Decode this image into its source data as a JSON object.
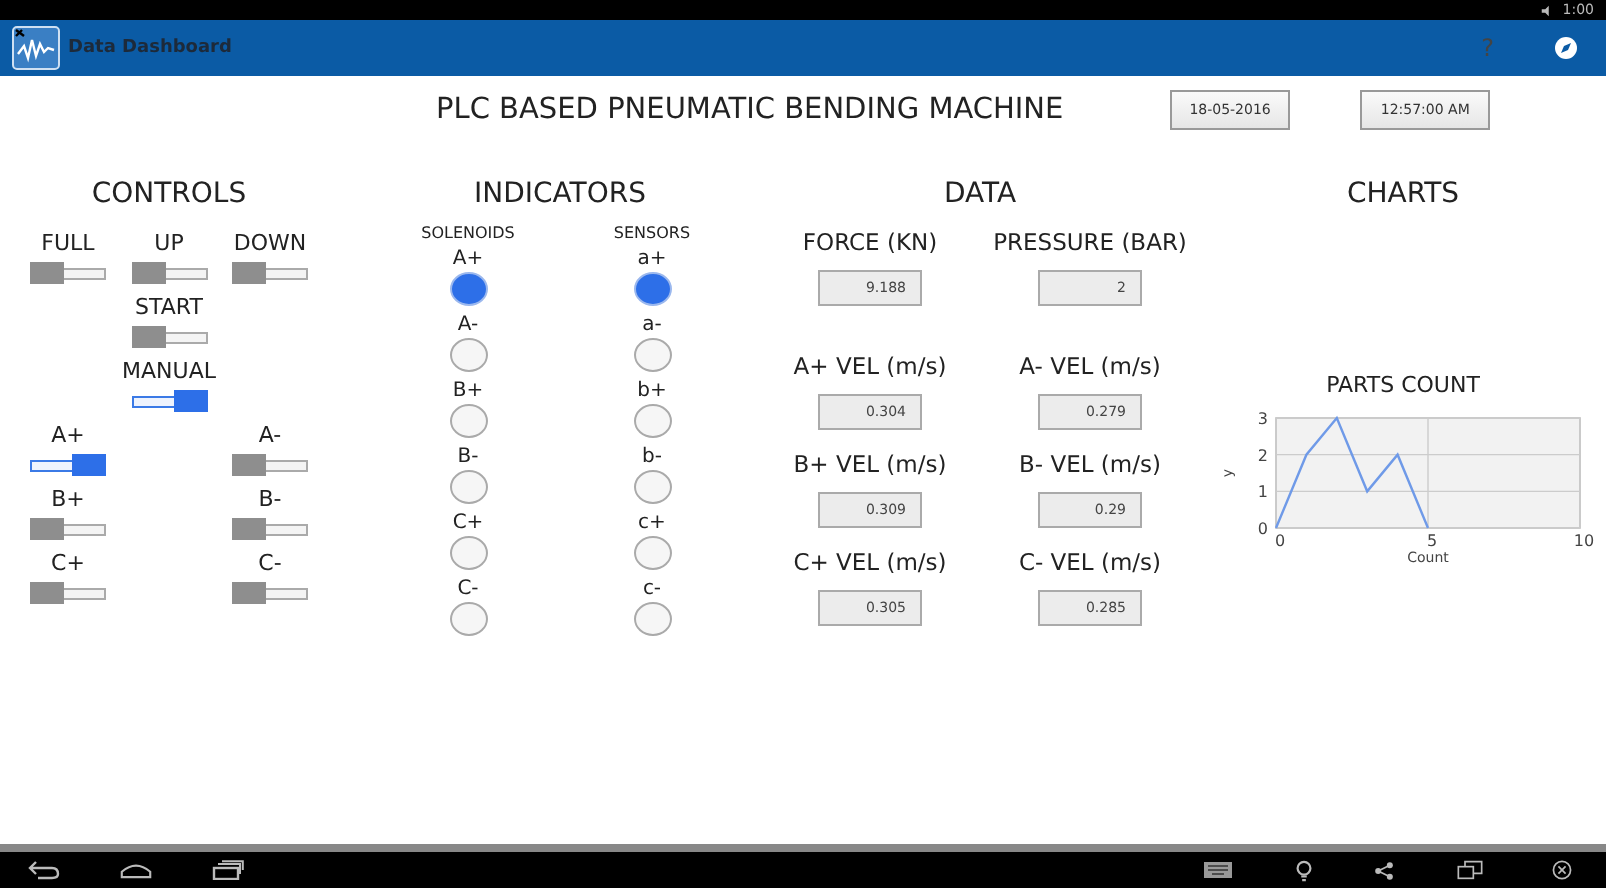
{
  "status_bar": {
    "time": "1:00"
  },
  "app_bar": {
    "title": "Data Dashboard",
    "help": "?"
  },
  "header": {
    "title": "PLC BASED PNEUMATIC BENDING MACHINE",
    "date": "18-05-2016",
    "time": "12:57:00 AM"
  },
  "controls": {
    "title": "CONTROLS",
    "rows": [
      [
        {
          "label": "FULL",
          "on": false
        },
        {
          "label": "UP",
          "on": false
        },
        {
          "label": "DOWN",
          "on": false
        }
      ],
      [
        {
          "label": "START",
          "on": false
        }
      ],
      [
        {
          "label": "MANUAL",
          "on": true
        }
      ],
      [
        {
          "label": "A+",
          "on": true
        },
        {
          "label": "A-",
          "on": false
        }
      ],
      [
        {
          "label": "B+",
          "on": false
        },
        {
          "label": "B-",
          "on": false
        }
      ],
      [
        {
          "label": "C+",
          "on": false
        },
        {
          "label": "C-",
          "on": false
        }
      ]
    ]
  },
  "indicators": {
    "title": "INDICATORS",
    "groups": [
      {
        "title": "SOLENOIDS",
        "items": [
          {
            "label": "A+",
            "on": true
          },
          {
            "label": "A-",
            "on": false
          },
          {
            "label": "B+",
            "on": false
          },
          {
            "label": "B-",
            "on": false
          },
          {
            "label": "C+",
            "on": false
          },
          {
            "label": "C-",
            "on": false
          }
        ]
      },
      {
        "title": "SENSORS",
        "items": [
          {
            "label": "a+",
            "on": true
          },
          {
            "label": "a-",
            "on": false
          },
          {
            "label": "b+",
            "on": false
          },
          {
            "label": "b-",
            "on": false
          },
          {
            "label": "c+",
            "on": false
          },
          {
            "label": "c-",
            "on": false
          }
        ]
      }
    ]
  },
  "data": {
    "title": "DATA",
    "fields": [
      {
        "label": "FORCE (KN)",
        "value": "9.188"
      },
      {
        "label": "PRESSURE (BAR)",
        "value": "2"
      },
      {
        "label": "A+ VEL (m/s)",
        "value": "0.304"
      },
      {
        "label": "A- VEL (m/s)",
        "value": "0.279"
      },
      {
        "label": "B+ VEL (m/s)",
        "value": "0.309"
      },
      {
        "label": "B- VEL (m/s)",
        "value": "0.29"
      },
      {
        "label": "C+ VEL (m/s)",
        "value": "0.305"
      },
      {
        "label": "C- VEL (m/s)",
        "value": "0.285"
      }
    ]
  },
  "charts": {
    "title": "CHARTS",
    "chart_data": {
      "type": "line",
      "title": "PARTS COUNT",
      "xlabel": "Count",
      "ylabel": "y",
      "x": [
        0,
        1,
        2,
        3,
        4,
        5
      ],
      "series": [
        {
          "color": "#6f9ae8",
          "values": [
            0,
            2,
            3,
            1,
            2,
            0
          ]
        }
      ],
      "grid": true,
      "xlim": [
        0,
        10
      ],
      "ylim": [
        0,
        3
      ],
      "xticks": [
        0,
        5,
        10
      ],
      "yticks": [
        0,
        1,
        2,
        3
      ]
    }
  }
}
